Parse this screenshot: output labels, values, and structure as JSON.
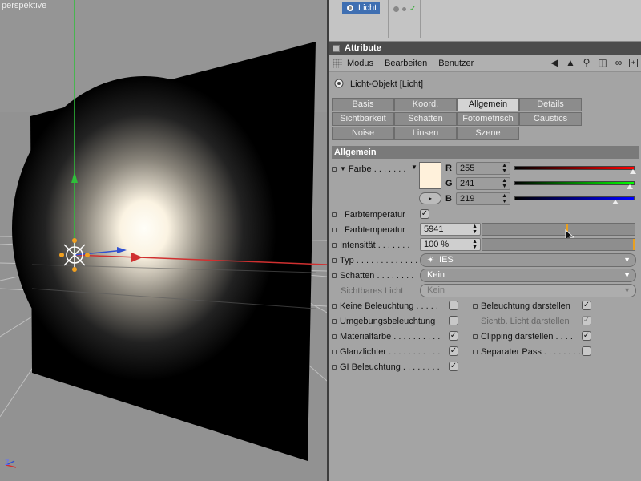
{
  "viewport": {
    "label": "perspektive",
    "axis_label": "Z"
  },
  "object_manager": {
    "object_name": "Licht"
  },
  "attributes": {
    "title": "Attribute",
    "menu": [
      "Modus",
      "Bearbeiten",
      "Benutzer"
    ],
    "object_title": "Licht-Objekt [Licht]",
    "tabs": [
      [
        "Basis",
        "Koord.",
        "Allgemein",
        "Details"
      ],
      [
        "Sichtbarkeit",
        "Schatten",
        "Fotometrisch",
        "Caustics"
      ],
      [
        "Noise",
        "Linsen",
        "Szene"
      ]
    ],
    "active_tab": "Allgemein",
    "section": "Allgemein",
    "farbe": {
      "label": "Farbe . . . . . . .",
      "r_label": "R",
      "r_value": "255",
      "g_label": "G",
      "g_value": "241",
      "b_label": "B",
      "b_value": "219",
      "swatch_color": "#fff1db"
    },
    "farbtemperatur_check_label": "Farbtemperatur",
    "farbtemperatur_label": "Farbtemperatur",
    "farbtemperatur_value": "5941",
    "intensitaet_label": "Intensität . . . . . . .",
    "intensitaet_value": "100 %",
    "typ_label": "Typ . . . . . . . . . . . . .",
    "typ_value": "IES",
    "schatten_label": "Schatten . . . . . . . .",
    "schatten_value": "Kein",
    "sichtbares_licht_label": "Sichtbares Licht",
    "sichtbares_licht_value": "Kein",
    "checks_left": [
      {
        "label": "Keine Beleuchtung . . . . .",
        "checked": false
      },
      {
        "label": "Umgebungsbeleuchtung",
        "checked": false
      },
      {
        "label": "Materialfarbe . . . . . . . . . .",
        "checked": true
      },
      {
        "label": "Glanzlichter . . . . . . . . . . .",
        "checked": true
      },
      {
        "label": "GI Beleuchtung . . . . . . . .",
        "checked": true
      }
    ],
    "checks_right": [
      {
        "label": "Beleuchtung darstellen",
        "checked": true,
        "dim": false
      },
      {
        "label": "Sichtb. Licht darstellen",
        "checked": true,
        "dim": true
      },
      {
        "label": "Clipping darstellen . . . .",
        "checked": true,
        "dim": false
      },
      {
        "label": "Separater Pass . . . . . . . .",
        "checked": false,
        "dim": false
      }
    ],
    "check_mark": "✓"
  }
}
